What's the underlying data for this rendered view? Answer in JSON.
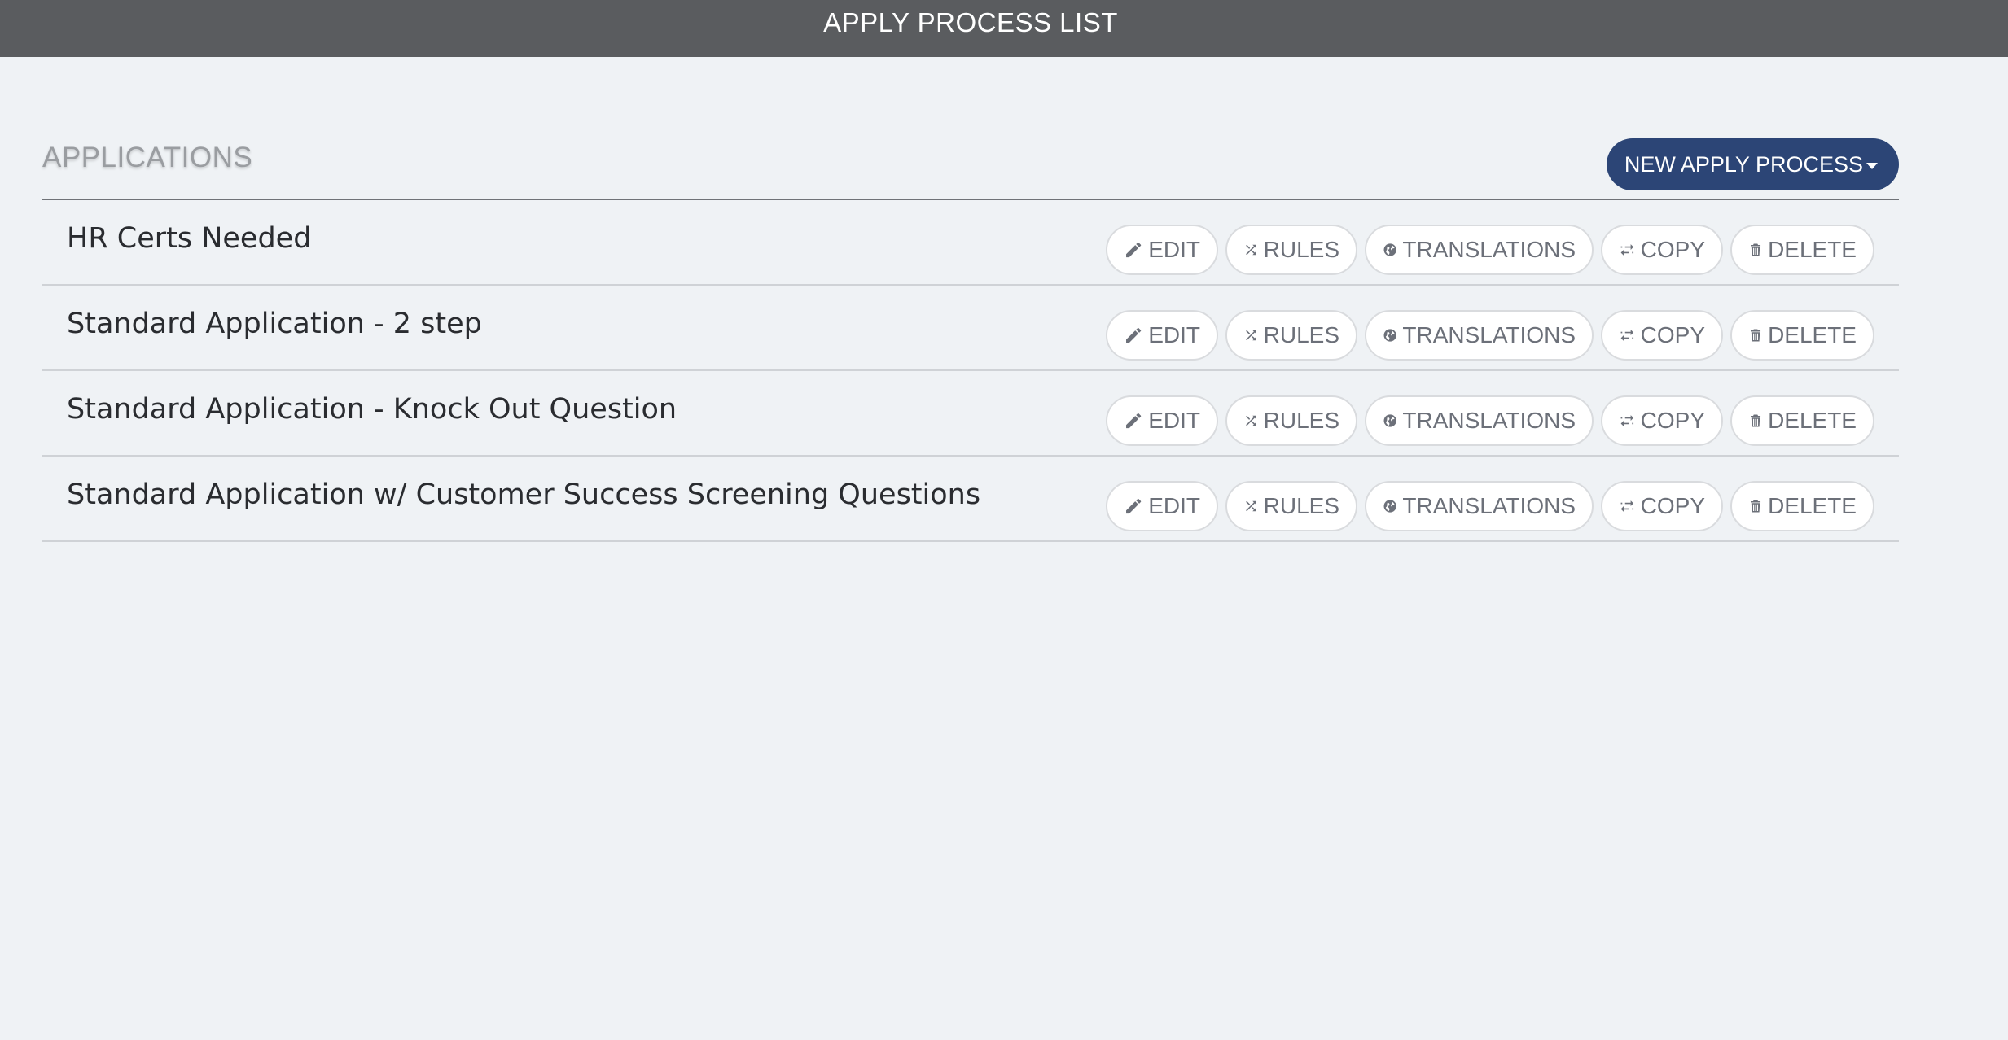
{
  "header": {
    "title": "APPLY PROCESS LIST"
  },
  "section": {
    "title": "APPLICATIONS",
    "new_button_label": "NEW APPLY PROCESS"
  },
  "actions": {
    "edit": "EDIT",
    "rules": "RULES",
    "translations": "TRANSLATIONS",
    "copy": "COPY",
    "delete": "DELETE"
  },
  "applications": [
    {
      "name": "HR Certs Needed"
    },
    {
      "name": "Standard Application - 2 step"
    },
    {
      "name": "Standard Application - Knock Out Question"
    },
    {
      "name": "Standard Application w/ Customer Success Screening Questions"
    }
  ],
  "colors": {
    "topbar": "#5a5c5f",
    "background": "#eff2f5",
    "primary_button": "#2c4576",
    "action_text": "#6c7079"
  },
  "icons": {
    "edit": "pencil-icon",
    "rules": "shuffle-icon",
    "translations": "globe-icon",
    "copy": "swap-arrows-icon",
    "delete": "trash-icon"
  }
}
